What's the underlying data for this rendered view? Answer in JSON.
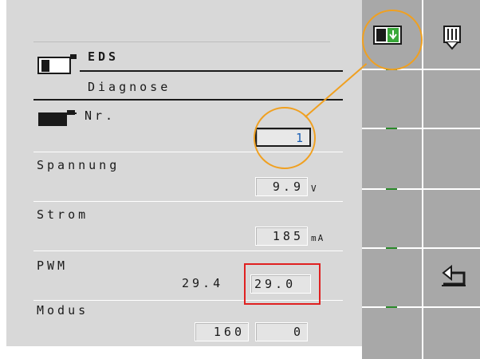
{
  "header": {
    "title": "EDS",
    "subtitle": "Diagnose"
  },
  "fields": {
    "nr_label": "Nr.",
    "nr_value": "1",
    "spannung_label": "Spannung",
    "spannung_value": "9.9",
    "spannung_unit": "V",
    "strom_label": "Strom",
    "strom_value": "185",
    "strom_unit": "mA",
    "pwm_label": "PWM",
    "pwm_actual": "29.4",
    "pwm_value": "29.0",
    "modus_label": "Modus",
    "modus_value1": "160",
    "modus_value2": "0"
  },
  "softkeys": {
    "top_left_icon": "download-to-device-icon",
    "top_right_icon": "memory-module-icon",
    "back_icon": "back-arrow-icon"
  },
  "colors": {
    "highlight_circle": "#f0a020",
    "highlight_box": "#e02020",
    "value_blue": "#1a5fb4"
  }
}
